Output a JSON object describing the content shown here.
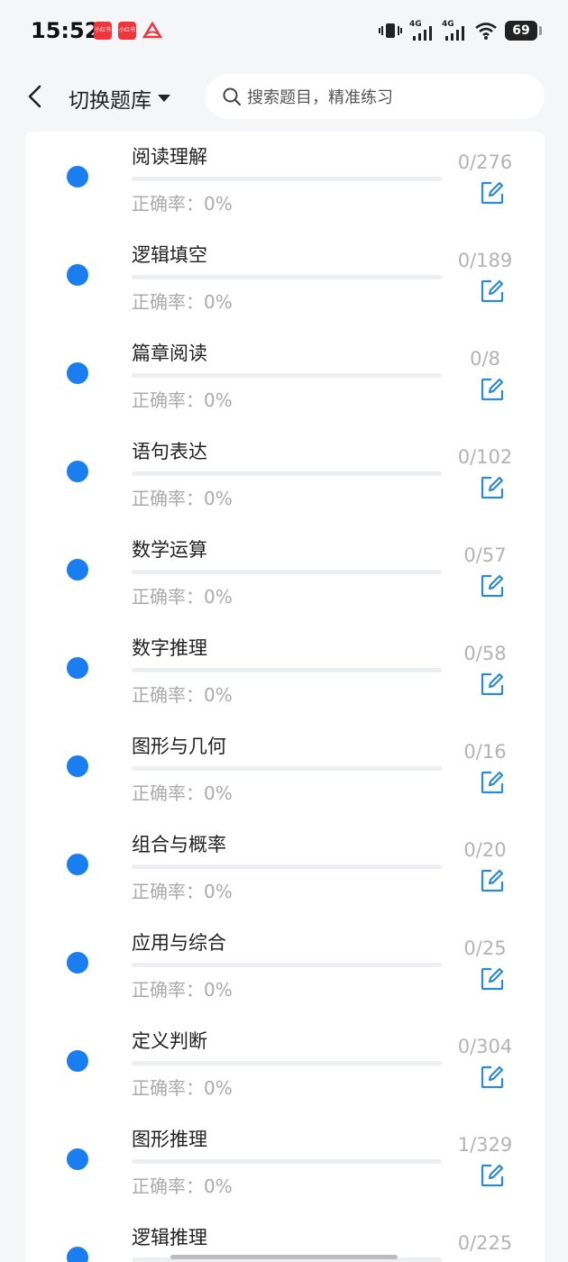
{
  "status_bar": {
    "time": "15:52",
    "notif_1": "小红书",
    "notif_2": "小红书",
    "battery": "69",
    "signal_1": "4G",
    "signal_2": "4G"
  },
  "header": {
    "title": "切换题库",
    "search_placeholder": "搜索题目，精准练习"
  },
  "colors": {
    "accent": "#1a7ef0",
    "edit_icon": "#2a8ad8"
  },
  "items": [
    {
      "name": "阅读理解",
      "accuracy": "正确率：0%",
      "count": "0/276",
      "progress": 0
    },
    {
      "name": "逻辑填空",
      "accuracy": "正确率：0%",
      "count": "0/189",
      "progress": 0
    },
    {
      "name": "篇章阅读",
      "accuracy": "正确率：0%",
      "count": "0/8",
      "progress": 0
    },
    {
      "name": "语句表达",
      "accuracy": "正确率：0%",
      "count": "0/102",
      "progress": 0
    },
    {
      "name": "数学运算",
      "accuracy": "正确率：0%",
      "count": "0/57",
      "progress": 0
    },
    {
      "name": "数字推理",
      "accuracy": "正确率：0%",
      "count": "0/58",
      "progress": 0
    },
    {
      "name": "图形与几何",
      "accuracy": "正确率：0%",
      "count": "0/16",
      "progress": 0
    },
    {
      "name": "组合与概率",
      "accuracy": "正确率：0%",
      "count": "0/20",
      "progress": 0
    },
    {
      "name": "应用与综合",
      "accuracy": "正确率：0%",
      "count": "0/25",
      "progress": 0
    },
    {
      "name": "定义判断",
      "accuracy": "正确率：0%",
      "count": "0/304",
      "progress": 0
    },
    {
      "name": "图形推理",
      "accuracy": "正确率：0%",
      "count": "1/329",
      "progress": 0
    },
    {
      "name": "逻辑推理",
      "accuracy": "",
      "count": "0/225",
      "progress": 0
    }
  ]
}
